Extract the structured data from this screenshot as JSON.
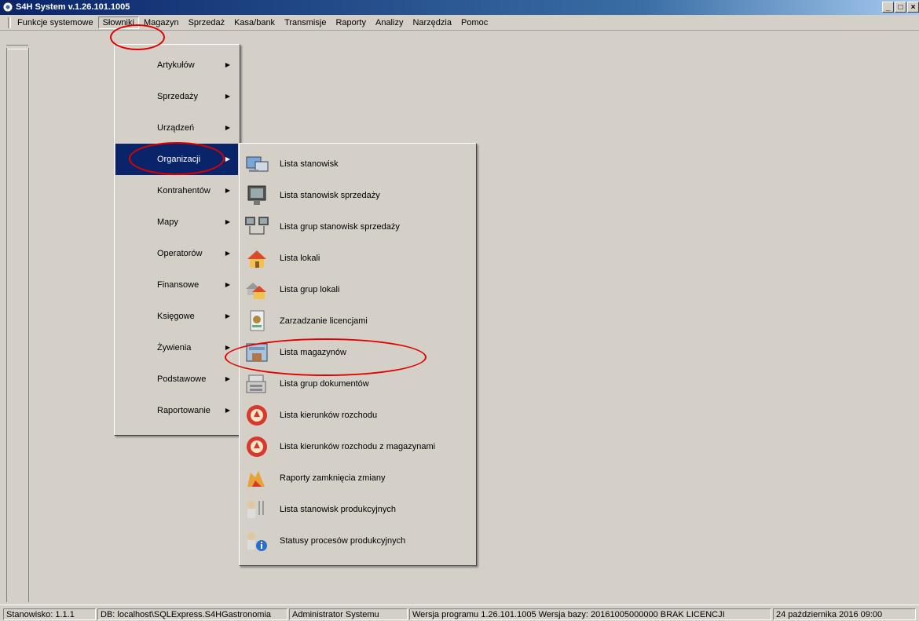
{
  "window": {
    "title": "S4H System v.1.26.101.1005",
    "min_glyph": "_",
    "max_glyph": "□",
    "close_glyph": "×"
  },
  "menubar": {
    "items": [
      "Funkcje systemowe",
      "Słowniki",
      "Magazyn",
      "Sprzedaż",
      "Kasa/bank",
      "Transmisje",
      "Raporty",
      "Analizy",
      "Narzędzia",
      "Pomoc"
    ],
    "active": "Słowniki"
  },
  "slowniki_menu": {
    "items": [
      "Artykułów",
      "Sprzedaży",
      "Urządzeń",
      "Organizacji",
      "Kontrahentów",
      "Mapy",
      "Operatorów",
      "Finansowe",
      "Księgowe",
      "Żywienia",
      "Podstawowe",
      "Raportowanie"
    ],
    "selected": "Organizacji"
  },
  "organizacji_menu": {
    "items": [
      {
        "label": "Lista stanowisk",
        "icon": "workstation-icon"
      },
      {
        "label": "Lista stanowisk sprzedaży",
        "icon": "monitor-icon"
      },
      {
        "label": "Lista grup stanowisk sprzedaży",
        "icon": "monitor-group-icon"
      },
      {
        "label": "Lista lokali",
        "icon": "house-icon"
      },
      {
        "label": "Lista grup lokali",
        "icon": "house-group-icon"
      },
      {
        "label": "Zarzadzanie licencjami",
        "icon": "license-icon"
      },
      {
        "label": "Lista magazynów",
        "icon": "warehouse-icon"
      },
      {
        "label": "Lista grup dokumentów",
        "icon": "cash-register-icon"
      },
      {
        "label": "Lista kierunków rozchodu",
        "icon": "direction-icon"
      },
      {
        "label": "Lista kierunków rozchodu z magazynami",
        "icon": "direction-warehouse-icon"
      },
      {
        "label": "Raporty zamknięcia zmiany",
        "icon": "shift-report-icon"
      },
      {
        "label": "Lista stanowisk produkcyjnych",
        "icon": "production-station-icon"
      },
      {
        "label": "Statusy procesów produkcyjnych",
        "icon": "production-status-icon"
      }
    ]
  },
  "statusbar": {
    "station": "Stanowisko: 1.1.1",
    "db": "DB: localhost\\SQLExpress.S4HGastronomia",
    "user": "Administrator Systemu",
    "version": "Wersja programu 1.26.101.1005 Wersja bazy: 20161005000000 BRAK LICENCJI",
    "datetime": "24 października 2016  09:00"
  },
  "colors": {
    "face": "#d4d0c8",
    "selection": "#0a246a",
    "annotation": "#e00000"
  }
}
